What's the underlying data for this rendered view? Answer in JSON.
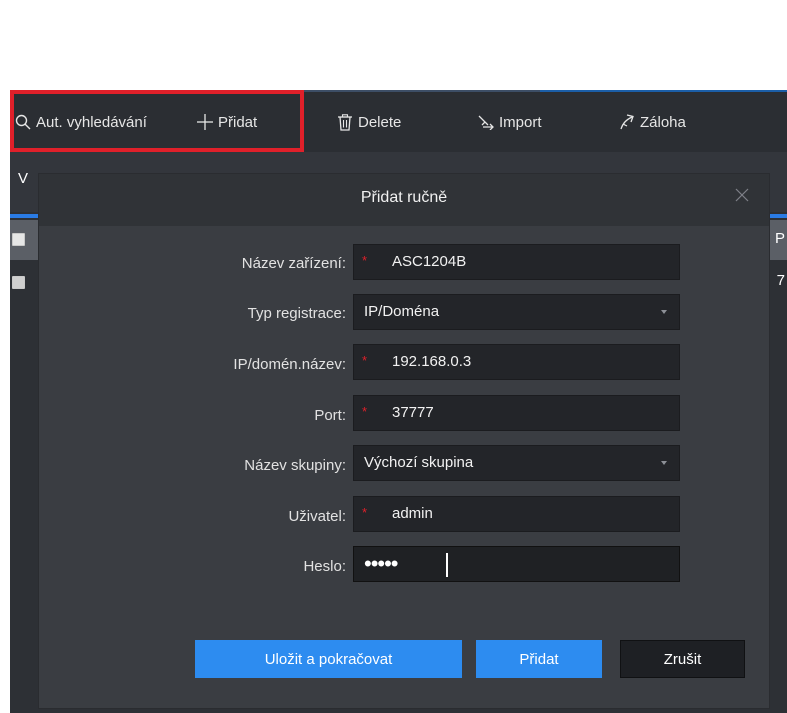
{
  "toolbar": {
    "auto_search": "Aut. vyhledávání",
    "add": "Přidat",
    "delete": "Delete",
    "import": "Import",
    "backup": "Záloha",
    "icons": [
      "search-icon",
      "plus-icon",
      "trash-icon",
      "import-icon",
      "backup-icon"
    ]
  },
  "background": {
    "header_letter": "V",
    "right_col_head": "P",
    "right_row_value": "7"
  },
  "dialog": {
    "title": "Přidat ručně",
    "fields": [
      {
        "label": "Název zařízení:",
        "value": "ASC1204B",
        "required": true,
        "type": "text"
      },
      {
        "label": "Typ registrace:",
        "value": "IP/Doména",
        "required": false,
        "type": "select"
      },
      {
        "label": "IP/domén.název:",
        "value": "192.168.0.3",
        "required": true,
        "type": "text"
      },
      {
        "label": "Port:",
        "value": "37777",
        "required": true,
        "type": "text"
      },
      {
        "label": "Název skupiny:",
        "value": "Výchozí skupina",
        "required": false,
        "type": "select"
      },
      {
        "label": "Uživatel:",
        "value": "admin",
        "required": true,
        "type": "text"
      },
      {
        "label": "Heslo:",
        "value": "•••••",
        "required": false,
        "type": "password"
      }
    ],
    "required_marker": "*",
    "buttons": {
      "save_continue": "Uložit a pokračovat",
      "add": "Přidat",
      "cancel": "Zrušit"
    }
  },
  "colors": {
    "highlight": "#e0202a",
    "primary": "#2d8cf0",
    "dialog_bg": "#3a3d42",
    "field_bg": "#232529"
  }
}
